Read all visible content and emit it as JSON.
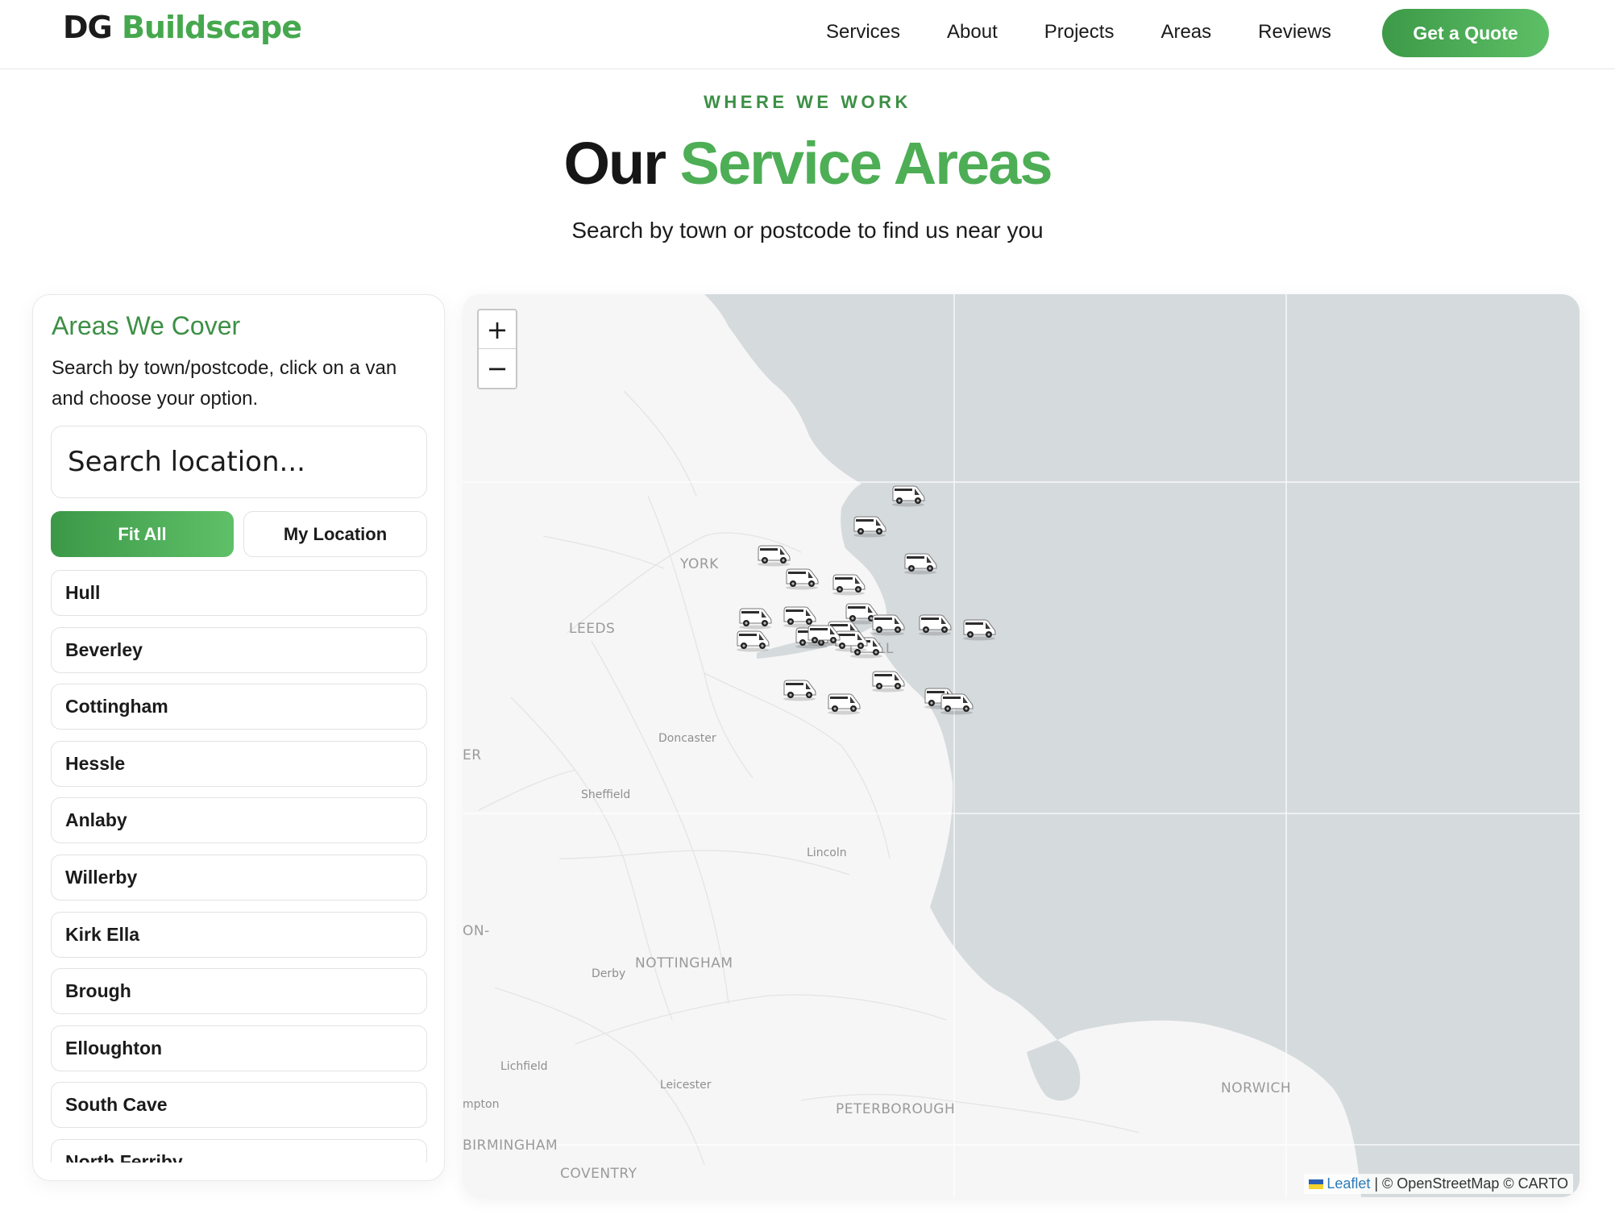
{
  "nav": {
    "logo_dg": "DG",
    "logo_brand": "Buildscape",
    "links": [
      "Services",
      "About",
      "Projects",
      "Areas",
      "Reviews"
    ],
    "cta": "Get a Quote"
  },
  "header": {
    "eyebrow": "WHERE WE WORK",
    "title_part1": "Our",
    "title_part2": "Service Areas",
    "subtitle": "Search by town or postcode to find us near you"
  },
  "sidebar": {
    "title": "Areas We Cover",
    "description": "Search by town/postcode, click on a van and choose your option.",
    "search_placeholder": "Search location...",
    "fit_all": "Fit All",
    "my_location": "My Location",
    "areas": [
      "Hull",
      "Beverley",
      "Cottingham",
      "Hessle",
      "Anlaby",
      "Willerby",
      "Kirk Ella",
      "Brough",
      "Elloughton",
      "South Cave",
      "North Ferriby"
    ]
  },
  "map": {
    "zoom_in": "+",
    "zoom_out": "−",
    "place_labels": [
      "YORK",
      "LEEDS",
      "ULL",
      "Doncaster",
      "ER",
      "Sheffield",
      "Lincoln",
      "ON-",
      "NOTTINGHAM",
      "Derby",
      "Lichfield",
      "Leicester",
      "mpton",
      "PETERBOROUGH",
      "NORWICH",
      "BIRMINGHAM",
      "COVENTRY"
    ],
    "attribution_link": "Leaflet",
    "attribution_rest": " | © OpenStreetMap © CARTO",
    "marker_count": 23,
    "land_color": "#f6f6f6",
    "sea_color": "#d5dadd"
  }
}
